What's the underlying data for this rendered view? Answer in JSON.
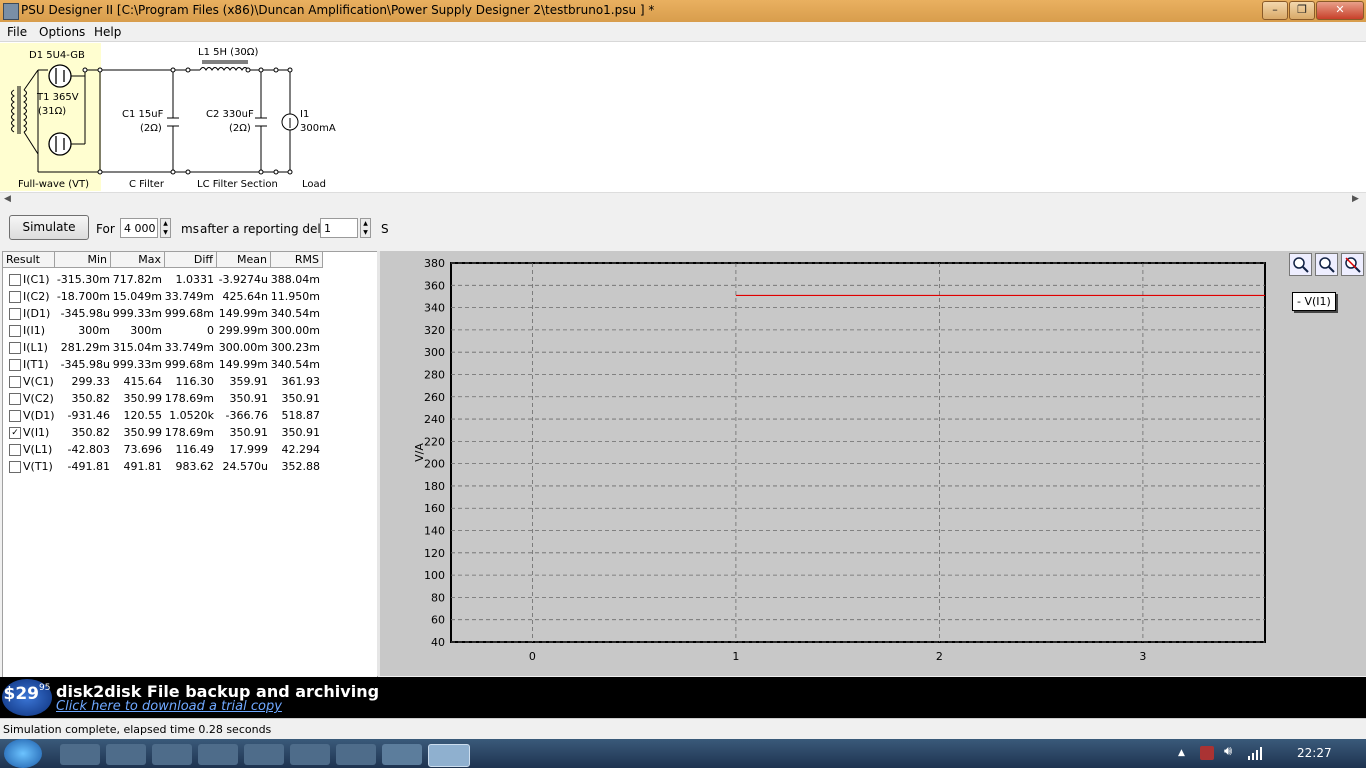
{
  "window": {
    "title": "PSU Designer II  [C:\\Program Files (x86)\\Duncan Amplification\\Power Supply Designer 2\\testbruno1.psu ] *",
    "minimize": "–",
    "maximize": "❐",
    "close": "✕"
  },
  "menu": [
    "File",
    "Options",
    "Help"
  ],
  "schematic": {
    "d1": "D1 5U4-GB",
    "t1_a": "T1 365V",
    "t1_b": "(31Ω)",
    "section_rectifier": "Full-wave (VT)",
    "l1": "L1 5H (30Ω)",
    "c1_a": "C1 15uF",
    "c1_b": "(2Ω)",
    "c2_a": "C2 330uF",
    "c2_b": "(2Ω)",
    "i1_a": "I1",
    "i1_b": "300mA",
    "section_c": "C Filter",
    "section_lc": "LC Filter Section",
    "section_load": "Load"
  },
  "sim": {
    "simulate_label": "Simulate",
    "for_label": "For",
    "duration": "4 000",
    "duration_unit": "ms",
    "delay_label": "after a reporting delay of",
    "delay": "1",
    "delay_unit": "S"
  },
  "results": {
    "headers": [
      "Result",
      "Min",
      "Max",
      "Diff",
      "Mean",
      "RMS"
    ],
    "rows": [
      {
        "name": "I(C1)",
        "checked": false,
        "min": "-315.30m",
        "max": "717.82m",
        "diff": "1.0331",
        "mean": "-3.9274u",
        "rms": "388.04m"
      },
      {
        "name": "I(C2)",
        "checked": false,
        "min": "-18.700m",
        "max": "15.049m",
        "diff": "33.749m",
        "mean": "425.64n",
        "rms": "11.950m"
      },
      {
        "name": "I(D1)",
        "checked": false,
        "min": "-345.98u",
        "max": "999.33m",
        "diff": "999.68m",
        "mean": "149.99m",
        "rms": "340.54m"
      },
      {
        "name": "I(I1)",
        "checked": false,
        "min": "300m",
        "max": "300m",
        "diff": "0",
        "mean": "299.99m",
        "rms": "300.00m"
      },
      {
        "name": "I(L1)",
        "checked": false,
        "min": "281.29m",
        "max": "315.04m",
        "diff": "33.749m",
        "mean": "300.00m",
        "rms": "300.23m"
      },
      {
        "name": "I(T1)",
        "checked": false,
        "min": "-345.98u",
        "max": "999.33m",
        "diff": "999.68m",
        "mean": "149.99m",
        "rms": "340.54m"
      },
      {
        "name": "V(C1)",
        "checked": false,
        "min": "299.33",
        "max": "415.64",
        "diff": "116.30",
        "mean": "359.91",
        "rms": "361.93"
      },
      {
        "name": "V(C2)",
        "checked": false,
        "min": "350.82",
        "max": "350.99",
        "diff": "178.69m",
        "mean": "350.91",
        "rms": "350.91"
      },
      {
        "name": "V(D1)",
        "checked": false,
        "min": "-931.46",
        "max": "120.55",
        "diff": "1.0520k",
        "mean": "-366.76",
        "rms": "518.87"
      },
      {
        "name": "V(I1)",
        "checked": true,
        "min": "350.82",
        "max": "350.99",
        "diff": "178.69m",
        "mean": "350.91",
        "rms": "350.91"
      },
      {
        "name": "V(L1)",
        "checked": false,
        "min": "-42.803",
        "max": "73.696",
        "diff": "116.49",
        "mean": "17.999",
        "rms": "42.294"
      },
      {
        "name": "V(T1)",
        "checked": false,
        "min": "-491.81",
        "max": "491.81",
        "diff": "983.62",
        "mean": "24.570u",
        "rms": "352.88"
      }
    ]
  },
  "chart_data": {
    "type": "line",
    "title": "",
    "xlabel": "",
    "ylabel": "V/A",
    "xlim": [
      -0.4,
      3.6
    ],
    "ylim": [
      40,
      380
    ],
    "xticks": [
      0,
      1,
      2,
      3
    ],
    "yticks": [
      40,
      60,
      80,
      100,
      120,
      140,
      160,
      180,
      200,
      220,
      240,
      260,
      280,
      300,
      320,
      340,
      360,
      380
    ],
    "grid": true,
    "legend_position": "top-right",
    "series": [
      {
        "name": "V(I1)",
        "color": "#e00000",
        "x": [
          1,
          3.6
        ],
        "y": [
          350.91,
          350.91
        ]
      }
    ]
  },
  "plot_tools": [
    "zoom-in-icon",
    "zoom-out-icon",
    "zoom-reset-icon"
  ],
  "legend_label": "V(I1)",
  "ad": {
    "price_main": "$29",
    "price_cents": "95",
    "headline": "disk2disk File backup and archiving",
    "link": "Click here to download a trial copy"
  },
  "status": "Simulation complete, elapsed time 0.28 seconds",
  "taskbar": {
    "clock": "22:27",
    "start_icon": "windows-start-icon"
  },
  "colors": {
    "titlebar": "#e0a555",
    "plot_bg": "#c8c8c8",
    "trace": "#e00000",
    "schematic_hilite": "#fffed0",
    "ad_link": "#6fa8ff"
  }
}
